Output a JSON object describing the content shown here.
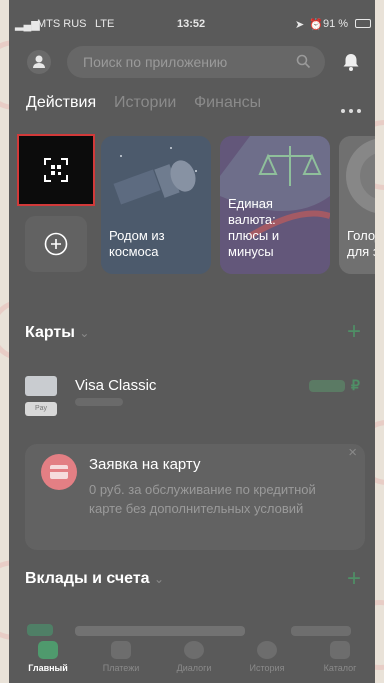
{
  "status_bar": {
    "carrier": "MTS RUS",
    "network": "LTE",
    "time": "13:52",
    "battery": "91 %"
  },
  "search": {
    "placeholder": "Поиск по приложению"
  },
  "tabs": [
    "Действия",
    "Истории",
    "Финансы"
  ],
  "stories": [
    {
      "title": "Родом из\nкосмоса"
    },
    {
      "title": "Единая\nвалюта:\nплюсы и\nминусы"
    },
    {
      "title": "Голод\nдля зд"
    }
  ],
  "cards": {
    "title": "Карты",
    "add_label": "+",
    "items": [
      {
        "name": "Visa Classic",
        "amount_suffix": "₽",
        "badge": "Pay"
      }
    ]
  },
  "promo": {
    "title": "Заявка на карту",
    "text": "0 руб. за обслуживание по кредитной карте без дополнительных условий",
    "close": "×"
  },
  "deposits": {
    "title": "Вклады и счета",
    "add_label": "+"
  },
  "bottom_nav": [
    "Главный",
    "Платежи",
    "Диалоги",
    "История",
    "Каталог"
  ],
  "colors": {
    "accent_green": "#4f9a6d",
    "promo_icon": "#e37f84",
    "qr_highlight": "#d23a3a"
  }
}
